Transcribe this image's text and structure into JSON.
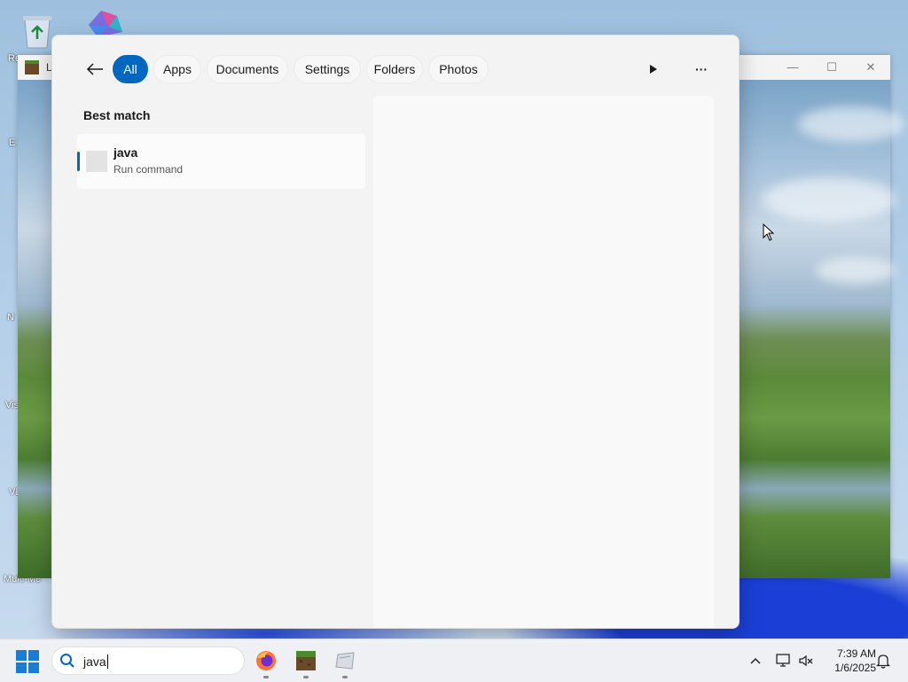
{
  "desktop": {
    "icons": [
      {
        "name": "recycle-bin-icon",
        "label": "Re"
      },
      {
        "name": "edge-icon",
        "label": "E"
      },
      {
        "name": "notepad-icon",
        "label": "N"
      },
      {
        "name": "vscode-icon",
        "label": "Vis"
      },
      {
        "name": "vlc-icon",
        "label": "VL"
      },
      {
        "name": "multi-icon",
        "label": "Multi-Me"
      }
    ]
  },
  "background_window": {
    "title": "L",
    "controls": {
      "minimize": "—",
      "maximize": "☐",
      "close": "✕"
    }
  },
  "search_panel": {
    "filters": [
      {
        "label": "All",
        "active": true
      },
      {
        "label": "Apps",
        "active": false
      },
      {
        "label": "Documents",
        "active": false
      },
      {
        "label": "Settings",
        "active": false
      },
      {
        "label": "Folders",
        "active": false
      },
      {
        "label": "Photos",
        "active": false
      }
    ],
    "play_icon": "play-icon",
    "more_label": "···",
    "section_title": "Best match",
    "best_match": {
      "name": "java",
      "subtitle": "Run command"
    }
  },
  "taskbar": {
    "search_value": "java",
    "apps": [
      "firefox-icon",
      "minecraft-icon",
      "app-icon"
    ],
    "clock": {
      "time": "7:39 AM",
      "date": "1/6/2025"
    }
  },
  "colors": {
    "accent": "#0067c0",
    "panel_bg": "#f3f3f3",
    "taskbar_bg": "#eef0f4"
  }
}
